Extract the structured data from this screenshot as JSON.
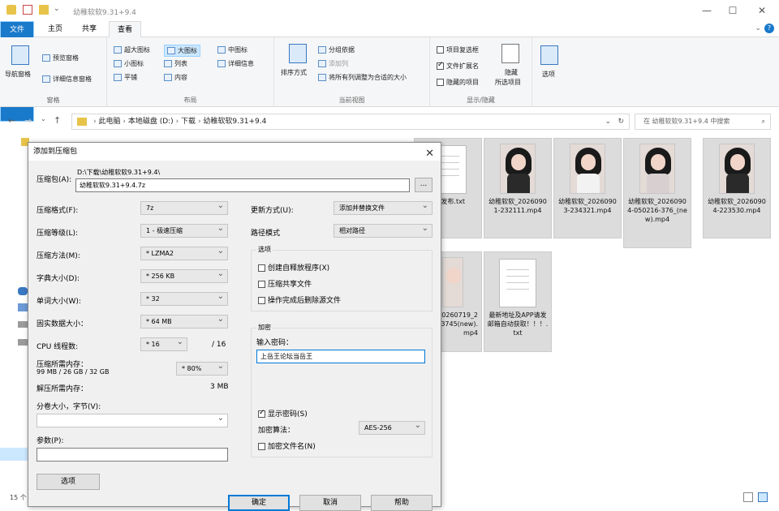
{
  "window": {
    "title": "幼稚软软9.31+9.4",
    "controls": {
      "minimize": "—",
      "maximize": "☐",
      "close": "✕"
    }
  },
  "ribbon_tabs": [
    "文件",
    "主页",
    "共享",
    "查看"
  ],
  "ribbon": {
    "panes": {
      "nav_pane": "导航窗格",
      "preview": "预览窗格",
      "details": "详细信息窗格",
      "label": "窗格"
    },
    "layout": {
      "items": [
        "超大图标",
        "大图标",
        "中图标",
        "小图标",
        "列表",
        "详细信息",
        "平铺",
        "内容"
      ],
      "label": "布局"
    },
    "current_view": {
      "sort": "排序方式",
      "group": "分组依据",
      "add_column": "添加列",
      "fit_columns": "将所有列调整为合适的大小",
      "label": "当前视图"
    },
    "show_hide": {
      "item_checkbox": "项目复选框",
      "file_ext": "文件扩展名",
      "hidden_items": "隐藏的项目",
      "hide_selected_1": "隐藏",
      "hide_selected_2": "所选项目",
      "label": "显示/隐藏",
      "options": "选项"
    }
  },
  "address": {
    "path": [
      "此电脑",
      "本地磁盘 (D:)",
      "下载",
      "幼稚软软9.31+9.4"
    ],
    "search_placeholder": "在 幼稚软软9.31+9.4 中搜索"
  },
  "files": [
    {
      "name": "地址发布.txt",
      "partial": true
    },
    {
      "name": "幼稚软软_20260901-232111.mp4"
    },
    {
      "name": "幼稚软软_20260903-234321.mp4"
    },
    {
      "name": "幼稚软软_20260904-050216-376_(new).mp4"
    },
    {
      "name": "幼稚软软_20260904-223530.mp4"
    },
    {
      "name": "软软_20260719_20...-013745(new).mp4",
      "partial": true
    },
    {
      "name": "最新地址及APP请发邮箱自动获取！！！.txt"
    }
  ],
  "status": {
    "count": "15 个"
  },
  "dialog": {
    "title": "添加到压缩包",
    "archive_label": "压缩包(A):",
    "archive_path": "D:\\下载\\幼稚软软9.31+9.4\\",
    "archive_name": "幼稚软软9.31+9.4.7z",
    "browse": "...",
    "format_label": "压缩格式(F):",
    "format_value": "7z",
    "level_label": "压缩等级(L):",
    "level_value": "1 - 极速压缩",
    "method_label": "压缩方法(M):",
    "method_value": "* LZMA2",
    "dict_label": "字典大小(D):",
    "dict_value": "* 256 KB",
    "word_label": "单词大小(W):",
    "word_value": "* 32",
    "solid_label": "固实数据大小：",
    "solid_value": "* 64 MB",
    "cpu_label": "CPU 线程数:",
    "cpu_value": "* 16",
    "cpu_total": "/ 16",
    "mem_label": "压缩所需内存：",
    "mem_detail": "99 MB / 26 GB / 32 GB",
    "mem_value": "* 80%",
    "decomp_label": "解压所需内存：",
    "decomp_value": "3 MB",
    "split_label": "分卷大小，字节(V):",
    "split_value": "",
    "params_label": "参数(P):",
    "params_value": "",
    "options_btn": "选项",
    "update_label": "更新方式(U):",
    "update_value": "添加并替换文件",
    "path_label": "路径模式",
    "path_value": "相对路径",
    "opts_group": "选项",
    "opt_sfx": "创建自释放程序(X)",
    "opt_shared": "压缩共享文件",
    "opt_delete": "操作完成后删除源文件",
    "enc_group": "加密",
    "pwd_label": "输入密码：",
    "pwd_value": "上岳王论坛当岳王",
    "show_pwd": "显示密码(S)",
    "enc_method_label": "加密算法：",
    "enc_method_value": "AES-256",
    "enc_names": "加密文件名(N)",
    "ok": "确定",
    "cancel": "取消",
    "help": "帮助"
  }
}
